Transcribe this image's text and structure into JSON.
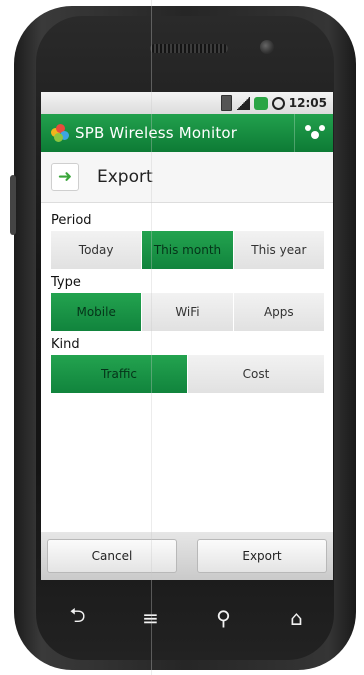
{
  "status": {
    "time": "12:05"
  },
  "app": {
    "title": "SPB Wireless Monitor"
  },
  "page": {
    "title": "Export"
  },
  "sections": {
    "period": {
      "label": "Period",
      "options": [
        "Today",
        "This month",
        "This year"
      ],
      "selected": "This month"
    },
    "type": {
      "label": "Type",
      "options": [
        "Mobile",
        "WiFi",
        "Apps"
      ],
      "selected": "Mobile"
    },
    "kind": {
      "label": "Kind",
      "options": [
        "Traffic",
        "Cost"
      ],
      "selected": "Traffic"
    }
  },
  "buttons": {
    "cancel": "Cancel",
    "export": "Export"
  },
  "colors": {
    "accent": "#1a9445",
    "title_bar": "#14873c"
  },
  "icons": {
    "status": [
      "battery-icon",
      "signal-icon",
      "green-status-icon",
      "alarm-icon"
    ],
    "title_left": "spb-logo-icon",
    "title_right": "network-icon",
    "header": "arrow-right-icon",
    "nav": [
      "back-icon",
      "menu-icon",
      "search-icon",
      "home-icon"
    ]
  }
}
